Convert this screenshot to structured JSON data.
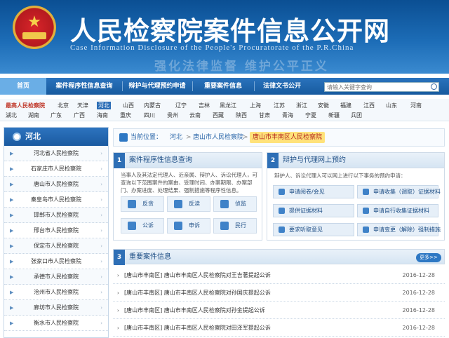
{
  "header": {
    "title": "人民检察院案件信息公开网",
    "subtitle": "Case Information Disclosure of the People's Procuratorate of the P.R.China",
    "slogan": "强化法律监督 维护公平正义"
  },
  "nav": {
    "items": [
      "首页",
      "案件程序性信息查询",
      "辩护与代理预约申请",
      "重要案件信息",
      "法律文书公开"
    ],
    "search_placeholder": "请输入关键字查询"
  },
  "regions": {
    "row1": [
      "最高人民检察院",
      "北京",
      "天津",
      "河北",
      "山西",
      "内蒙古",
      "辽宁",
      "吉林",
      "黑龙江",
      "上海",
      "江苏",
      "浙江",
      "安徽",
      "福建",
      "江西",
      "山东",
      "河南"
    ],
    "row2": [
      "湖北",
      "湖南",
      "广东",
      "广西",
      "海南",
      "重庆",
      "四川",
      "贵州",
      "云南",
      "西藏",
      "陕西",
      "甘肃",
      "青海",
      "宁夏",
      "新疆",
      "兵团"
    ],
    "selected": "河北"
  },
  "sidebar": {
    "title": "河北",
    "items": [
      "河北省人民检察院",
      "石家庄市人民检察院",
      "唐山市人民检察院",
      "秦皇岛市人民检察院",
      "邯郸市人民检察院",
      "邢台市人民检察院",
      "保定市人民检察院",
      "张家口市人民检察院",
      "承德市人民检察院",
      "沧州市人民检察院",
      "廊坊市人民检察院",
      "衡水市人民检察院"
    ]
  },
  "breadcrumb": {
    "label": "当前位置：",
    "items": [
      "河北",
      "唐山市人民检察院",
      "唐山市丰南区人民检察院"
    ],
    "separator": ">"
  },
  "panel1": {
    "num": "1",
    "title": "案件程序性信息查询",
    "desc": "当事人及其法定代理人、近亲属、辩护人、诉讼代理人，可查询以下范围案件的案由、受理时间、办案期限、办案部门、办案进度、处理结果、强制措施等程序性信息。",
    "buttons": [
      "反贪",
      "反渎",
      "侦监",
      "公诉",
      "申诉",
      "民行"
    ]
  },
  "panel2": {
    "num": "2",
    "title": "辩护与代理网上预约",
    "desc": "辩护人、诉讼代理人可以网上进行以下事务的预约申请：",
    "buttons": [
      "申请阅卷/会见",
      "申请收集（调取）证据材料",
      "提供证据材料",
      "申请自行收集证据材料",
      "要求听取意见",
      "申请变更（解除）强制措施"
    ]
  },
  "panel3": {
    "num": "3",
    "title": "重要案件信息",
    "more": "更多>>",
    "rows": [
      {
        "text": "[唐山市丰南区] 唐山市丰南区人民检察院对王吉著提起公诉",
        "date": "2016-12-28"
      },
      {
        "text": "[唐山市丰南区] 唐山市丰南区人民检察院对孙国庆提起公诉",
        "date": "2016-12-28"
      },
      {
        "text": "[唐山市丰南区] 唐山市丰南区人民检察院对孙金提起公诉",
        "date": "2016-12-28"
      },
      {
        "text": "[唐山市丰南区] 唐山市丰南区人民检察院对田泽军提起公诉",
        "date": "2016-12-28"
      }
    ]
  }
}
